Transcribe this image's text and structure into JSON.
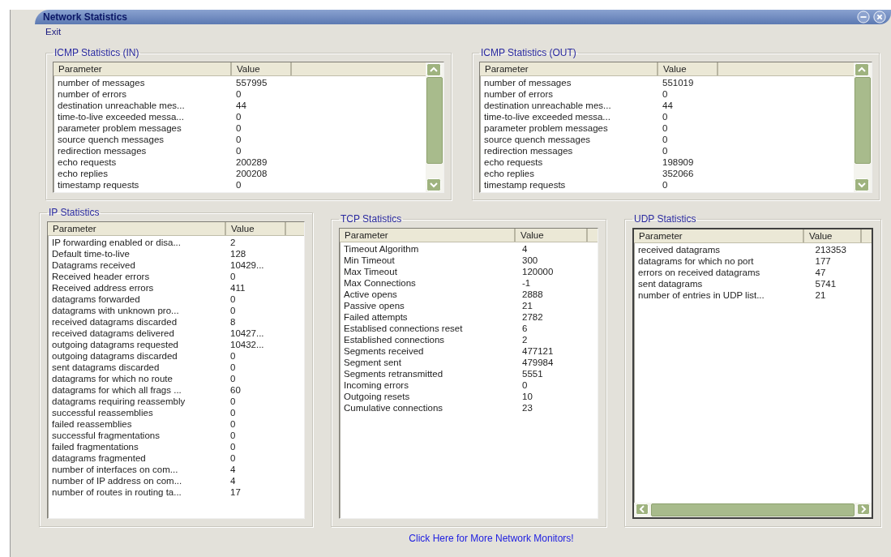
{
  "window": {
    "title": "Network Statistics"
  },
  "menu": [
    {
      "label": "Exit"
    }
  ],
  "groups": [
    {
      "title": "ICMP Statistics (IN)",
      "vertical_scrollbar": true,
      "horizontal_scrollbar": false,
      "columns": [
        "Parameter",
        "Value"
      ],
      "rows": [
        [
          "number of messages",
          "557995"
        ],
        [
          "number of errors",
          "0"
        ],
        [
          "destination unreachable mes...",
          "44"
        ],
        [
          "time-to-live exceeded messa...",
          "0"
        ],
        [
          "parameter problem messages",
          "0"
        ],
        [
          "source quench messages",
          "0"
        ],
        [
          "redirection messages",
          "0"
        ],
        [
          "echo requests",
          "200289"
        ],
        [
          "echo replies",
          "200208"
        ],
        [
          "timestamp requests",
          "0"
        ]
      ]
    },
    {
      "title": "ICMP Statistics (OUT)",
      "vertical_scrollbar": true,
      "horizontal_scrollbar": false,
      "columns": [
        "Parameter",
        "Value"
      ],
      "rows": [
        [
          "number of messages",
          "551019"
        ],
        [
          "number of errors",
          "0"
        ],
        [
          "destination unreachable mes...",
          "44"
        ],
        [
          "time-to-live exceeded messa...",
          "0"
        ],
        [
          "parameter problem messages",
          "0"
        ],
        [
          "source quench messages",
          "0"
        ],
        [
          "redirection messages",
          "0"
        ],
        [
          "echo requests",
          "198909"
        ],
        [
          "echo replies",
          "352066"
        ],
        [
          "timestamp requests",
          "0"
        ]
      ]
    },
    {
      "title": "IP Statistics",
      "vertical_scrollbar": false,
      "horizontal_scrollbar": false,
      "columns": [
        "Parameter",
        "Value"
      ],
      "rows": [
        [
          "IP forwarding enabled or disa...",
          "2"
        ],
        [
          "Default time-to-live",
          "128"
        ],
        [
          "Datagrams received",
          "10429..."
        ],
        [
          "Received header errors",
          "0"
        ],
        [
          "Received address errors",
          "411"
        ],
        [
          "datagrams forwarded",
          "0"
        ],
        [
          "datagrams with unknown pro...",
          "0"
        ],
        [
          "received datagrams discarded",
          "8"
        ],
        [
          "received datagrams delivered",
          "10427..."
        ],
        [
          "outgoing datagrams requested",
          "10432..."
        ],
        [
          "outgoing datagrams discarded",
          "0"
        ],
        [
          "sent datagrams discarded",
          "0"
        ],
        [
          "datagrams for which no route",
          "0"
        ],
        [
          "datagrams for which all frags ...",
          "60"
        ],
        [
          "datagrams requiring reassembly",
          "0"
        ],
        [
          "successful reassemblies",
          "0"
        ],
        [
          "failed reassemblies",
          "0"
        ],
        [
          "successful fragmentations",
          "0"
        ],
        [
          "failed fragmentations",
          "0"
        ],
        [
          "datagrams fragmented",
          "0"
        ],
        [
          "number of interfaces on com...",
          "4"
        ],
        [
          "number of IP address on com...",
          "4"
        ],
        [
          "number of routes in routing ta...",
          "17"
        ]
      ]
    },
    {
      "title": "TCP Statistics",
      "vertical_scrollbar": false,
      "horizontal_scrollbar": false,
      "columns": [
        "Parameter",
        "Value"
      ],
      "rows": [
        [
          "Timeout Algorithm",
          "4"
        ],
        [
          "Min Timeout",
          "300"
        ],
        [
          "Max Timeout",
          "120000"
        ],
        [
          "Max Connections",
          "-1"
        ],
        [
          "Active opens",
          "2888"
        ],
        [
          "Passive opens",
          "21"
        ],
        [
          "Failed attempts",
          "2782"
        ],
        [
          "Establised connections reset",
          "6"
        ],
        [
          "Established connections",
          "2"
        ],
        [
          "Segments received",
          "477121"
        ],
        [
          "Segment sent",
          "479984"
        ],
        [
          "Segments retransmitted",
          "5551"
        ],
        [
          "Incoming errors",
          "0"
        ],
        [
          "Outgoing resets",
          "10"
        ],
        [
          "Cumulative connections",
          "23"
        ]
      ]
    },
    {
      "title": "UDP Statistics",
      "vertical_scrollbar": false,
      "horizontal_scrollbar": true,
      "columns": [
        "Parameter",
        "Value"
      ],
      "rows": [
        [
          "received datagrams",
          "213353"
        ],
        [
          "datagrams for which no port",
          "177"
        ],
        [
          "errors on received datagrams",
          "47"
        ],
        [
          "sent datagrams",
          "5741"
        ],
        [
          "number of entries in UDP list...",
          "21"
        ]
      ]
    }
  ],
  "footer_link": "Click Here for More Network Monitors!"
}
